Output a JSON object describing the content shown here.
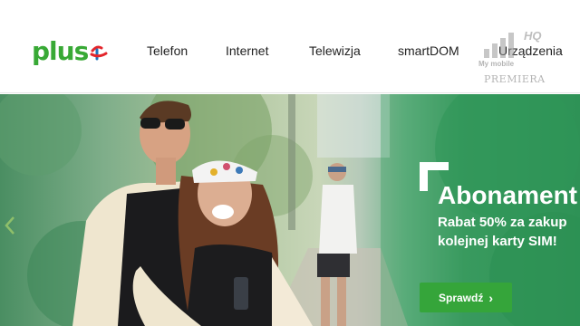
{
  "brand": {
    "logo_text": "plus",
    "color": "#38a935",
    "accent_red": "#e3252b",
    "accent_blue": "#1e73be"
  },
  "nav": {
    "items": [
      {
        "label": "Telefon"
      },
      {
        "label": "Internet"
      },
      {
        "label": "Telewizja"
      },
      {
        "label": "smartDOM"
      },
      {
        "label": "Urządzenia"
      }
    ]
  },
  "watermark": {
    "hq": "HQ",
    "sub": "My mobile",
    "premiera": "PREMIERA"
  },
  "hero": {
    "title": "Abonament",
    "subtitle_line1": "Rabat 50% za zakup",
    "subtitle_line2": "kolejnej karty SIM!",
    "cta_label": "Sprawdź",
    "cta_color": "#35a53a",
    "prev_icon": "chevron-left-icon"
  }
}
